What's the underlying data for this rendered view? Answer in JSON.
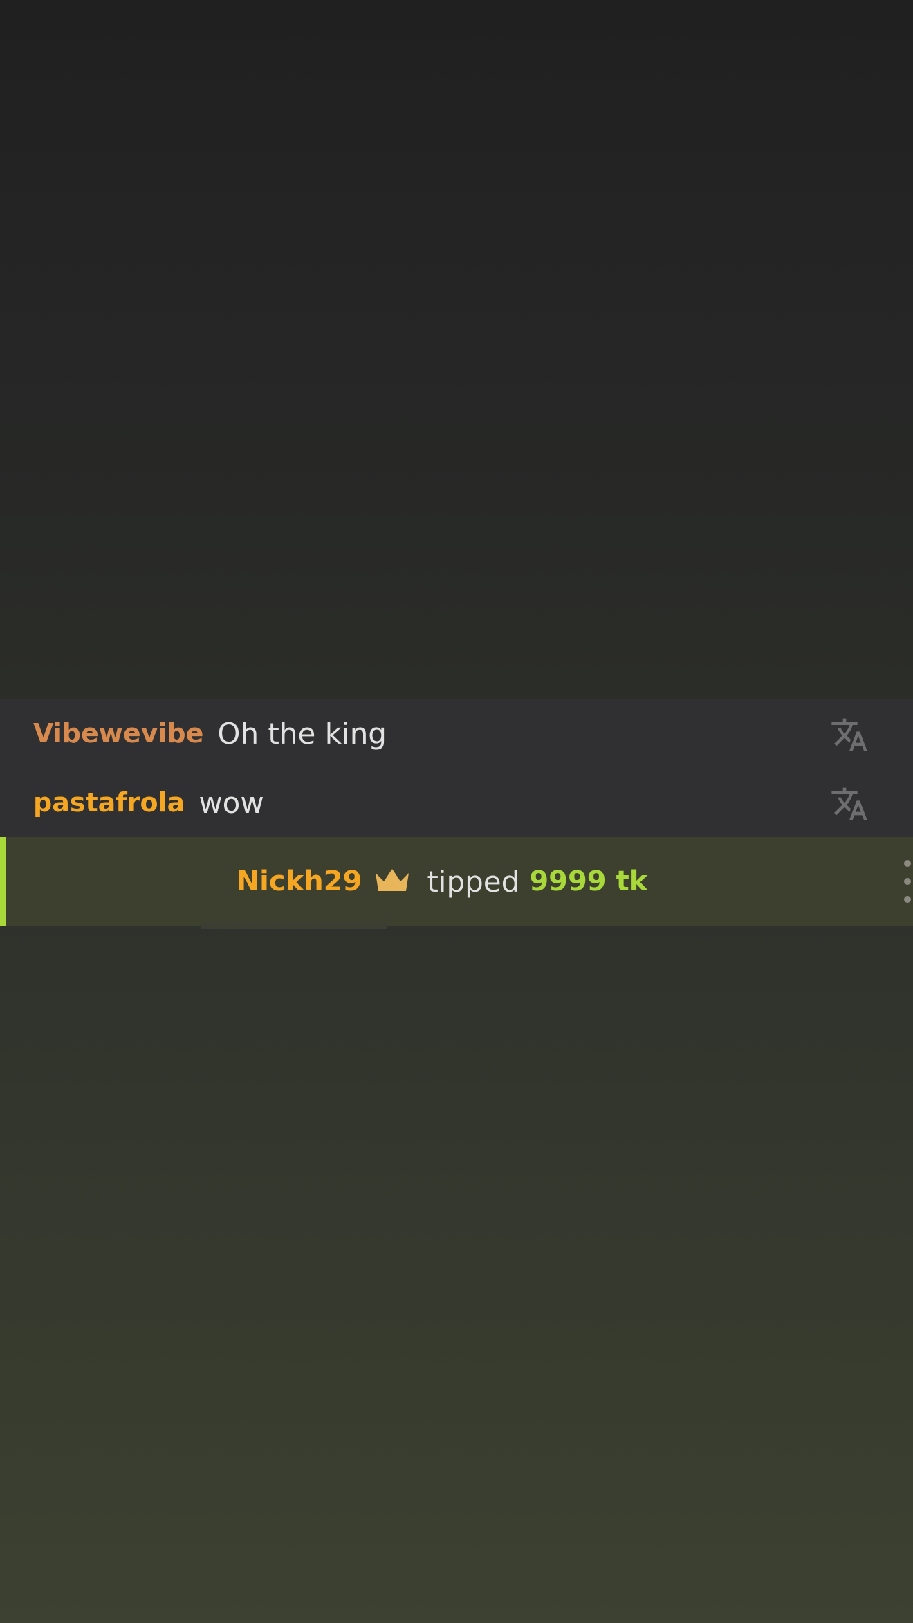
{
  "chat": {
    "messages": [
      {
        "username": "Vibewevibe",
        "username_color": "#d88a4e",
        "text": "Oh the king",
        "action_icon": "translate-icon"
      },
      {
        "username": "pastafrola",
        "username_color": "#f5a623",
        "text": "wow",
        "action_icon": "translate-icon"
      }
    ],
    "tip_event": {
      "username": "Nickh29",
      "username_color": "#f5a623",
      "badge_icon": "crown-icon",
      "badge_color": "#e8b55a",
      "verb": "tipped",
      "amount": "9999 tk",
      "amount_color": "#a8d83a",
      "accent_color": "#a8d83a",
      "menu_icon": "more-vertical-icon"
    }
  }
}
